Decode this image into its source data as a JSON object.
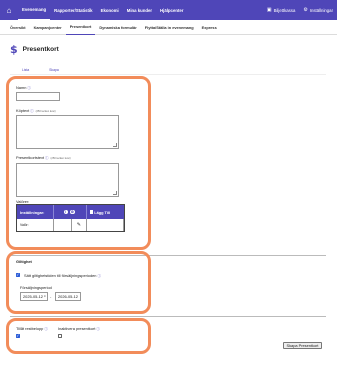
{
  "topnav": {
    "items": [
      {
        "label": "Evenemang",
        "active": true
      },
      {
        "label": "Rapporter/Statistik",
        "active": false
      },
      {
        "label": "Ekonomi",
        "active": false
      },
      {
        "label": "Mina kunder",
        "active": false
      },
      {
        "label": "Hjälpcenter",
        "active": false
      }
    ],
    "right": [
      {
        "label": "Biljettkassa",
        "icon": "ticket-icon"
      },
      {
        "label": "Inställningar",
        "icon": "gear-icon"
      }
    ]
  },
  "subnav": {
    "items": [
      {
        "label": "Översikt",
        "active": false
      },
      {
        "label": "Kampanjcenter",
        "active": false
      },
      {
        "label": "Presentkort",
        "active": true
      },
      {
        "label": "Dynamiska formulär",
        "active": false
      },
      {
        "label": "Flytta/Ställa in evenemang",
        "active": false
      },
      {
        "label": "Express",
        "active": false
      }
    ]
  },
  "page": {
    "title": "Presentkort",
    "tabs": [
      "Lista",
      "Skapa"
    ]
  },
  "form": {
    "name_label": "Namn",
    "buy_text_label": "Köptext",
    "buy_text_hint": "(250 tecken kvar)",
    "card_text_label": "Presentkortstext",
    "card_text_hint": "(250 tecken kvar)",
    "values_label": "Valörer:",
    "values_table": {
      "col_settings": "Inställningar:",
      "col_add": "Lägg Till",
      "row_label": "Valör:"
    }
  },
  "validity": {
    "heading": "Giltighet",
    "use_sales_period_label": "Sätt giltighetstiden till försäljningsperioden",
    "use_sales_period_checked": true,
    "sales_period_label": "Försäljningsperiod",
    "start_date": "2025-05-12",
    "end_date": "2026-05-12",
    "separator": "-"
  },
  "options": {
    "allow_remainder_label": "Tillåt restbelopp",
    "allow_remainder_checked": true,
    "inactivate_label": "Inaktivera presentkort",
    "inactivate_checked": false
  },
  "actions": {
    "create_label": "Skapa Presentkort"
  },
  "colors": {
    "brand": "#4f46b8",
    "highlight": "#f28c5a"
  }
}
